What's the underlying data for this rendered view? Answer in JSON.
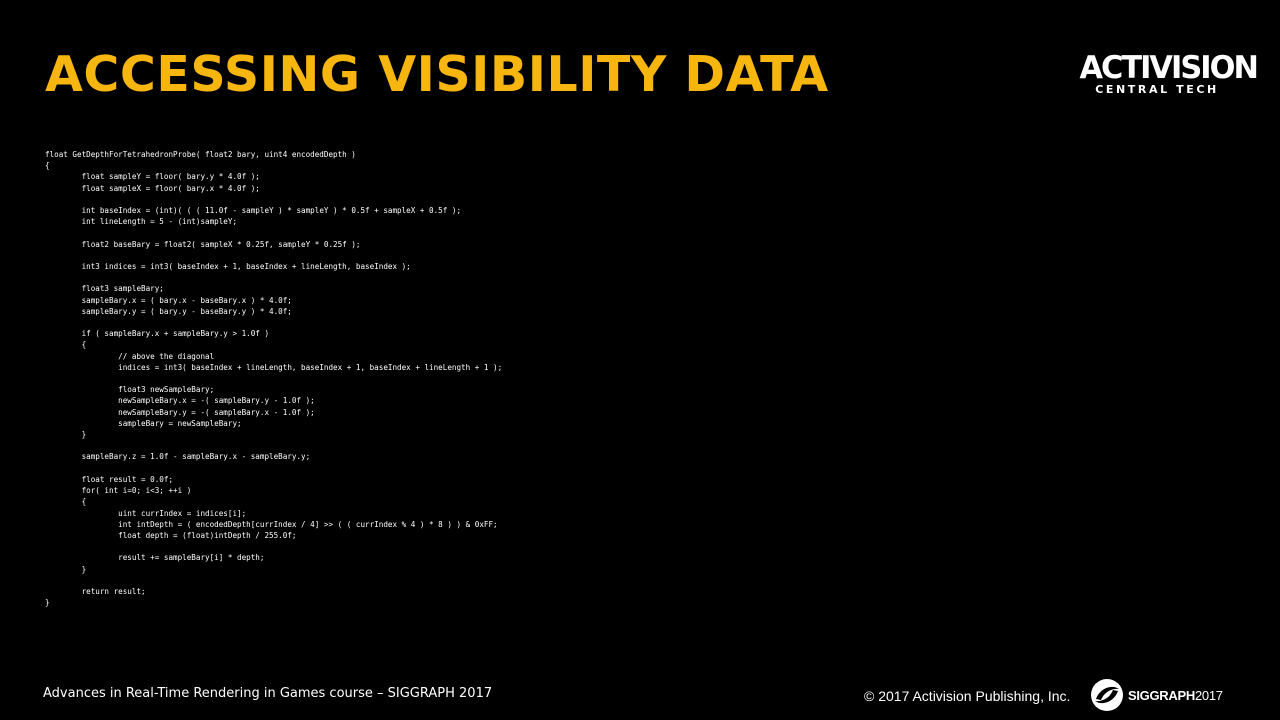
{
  "slide": {
    "title": "ACCESSING VISIBILITY DATA",
    "code": "float GetDepthForTetrahedronProbe( float2 bary, uint4 encodedDepth )\n{\n\t\tfloat sampleY = floor( bary.y * 4.0f );\n\t\tfloat sampleX = floor( bary.x * 4.0f );\n\n\t\tint baseIndex = (int)( ( ( 11.0f - sampleY ) * sampleY ) * 0.5f + sampleX + 0.5f );\n\t\tint lineLength = 5 - (int)sampleY;\n\n\t\tfloat2 baseBary = float2( sampleX * 0.25f, sampleY * 0.25f );\n\n\t\tint3 indices = int3( baseIndex + 1, baseIndex + lineLength, baseIndex );\n\n\t\tfloat3 sampleBary;\n\t\tsampleBary.x = ( bary.x - baseBary.x ) * 4.0f;\n\t\tsampleBary.y = ( bary.y - baseBary.y ) * 4.0f;\n\n\t\tif ( sampleBary.x + sampleBary.y > 1.0f )\n\t\t{\n\t\t\t\t// above the diagonal\n\t\t\t\tindices = int3( baseIndex + lineLength, baseIndex + 1, baseIndex + lineLength + 1 );\n\n\t\t\t\tfloat3 newSampleBary;\n\t\t\t\tnewSampleBary.x = -( sampleBary.y - 1.0f );\n\t\t\t\tnewSampleBary.y = -( sampleBary.x - 1.0f );\n\t\t\t\tsampleBary = newSampleBary;\n\t\t}\n\n\t\tsampleBary.z = 1.0f - sampleBary.x - sampleBary.y;\n\n\t\tfloat result = 0.0f;\n\t\tfor( int i=0; i<3; ++i )\n\t\t{\n\t\t\t\tuint currIndex = indices[i];\n\t\t\t\tint intDepth = ( encodedDepth[currIndex / 4] >> ( ( currIndex % 4 ) * 8 ) ) & 0xFF;\n\t\t\t\tfloat depth = (float)intDepth / 255.0f;\n\n\t\t\t\tresult += sampleBary[i] * depth;\n\t\t}\n\n\t\treturn result;\n}"
  },
  "logo": {
    "brand": "ACTIVISION",
    "subtitle": "CENTRAL TECH"
  },
  "footer": {
    "course": "Advances in Real-Time Rendering in Games course – SIGGRAPH 2017",
    "copyright": "© 2017 Activision Publishing, Inc.",
    "siggraph": "SIGGRAPH",
    "siggraph_year": "2017"
  },
  "colors": {
    "title": "#F6B60F",
    "background": "#000000",
    "text": "#FFFFFF"
  }
}
